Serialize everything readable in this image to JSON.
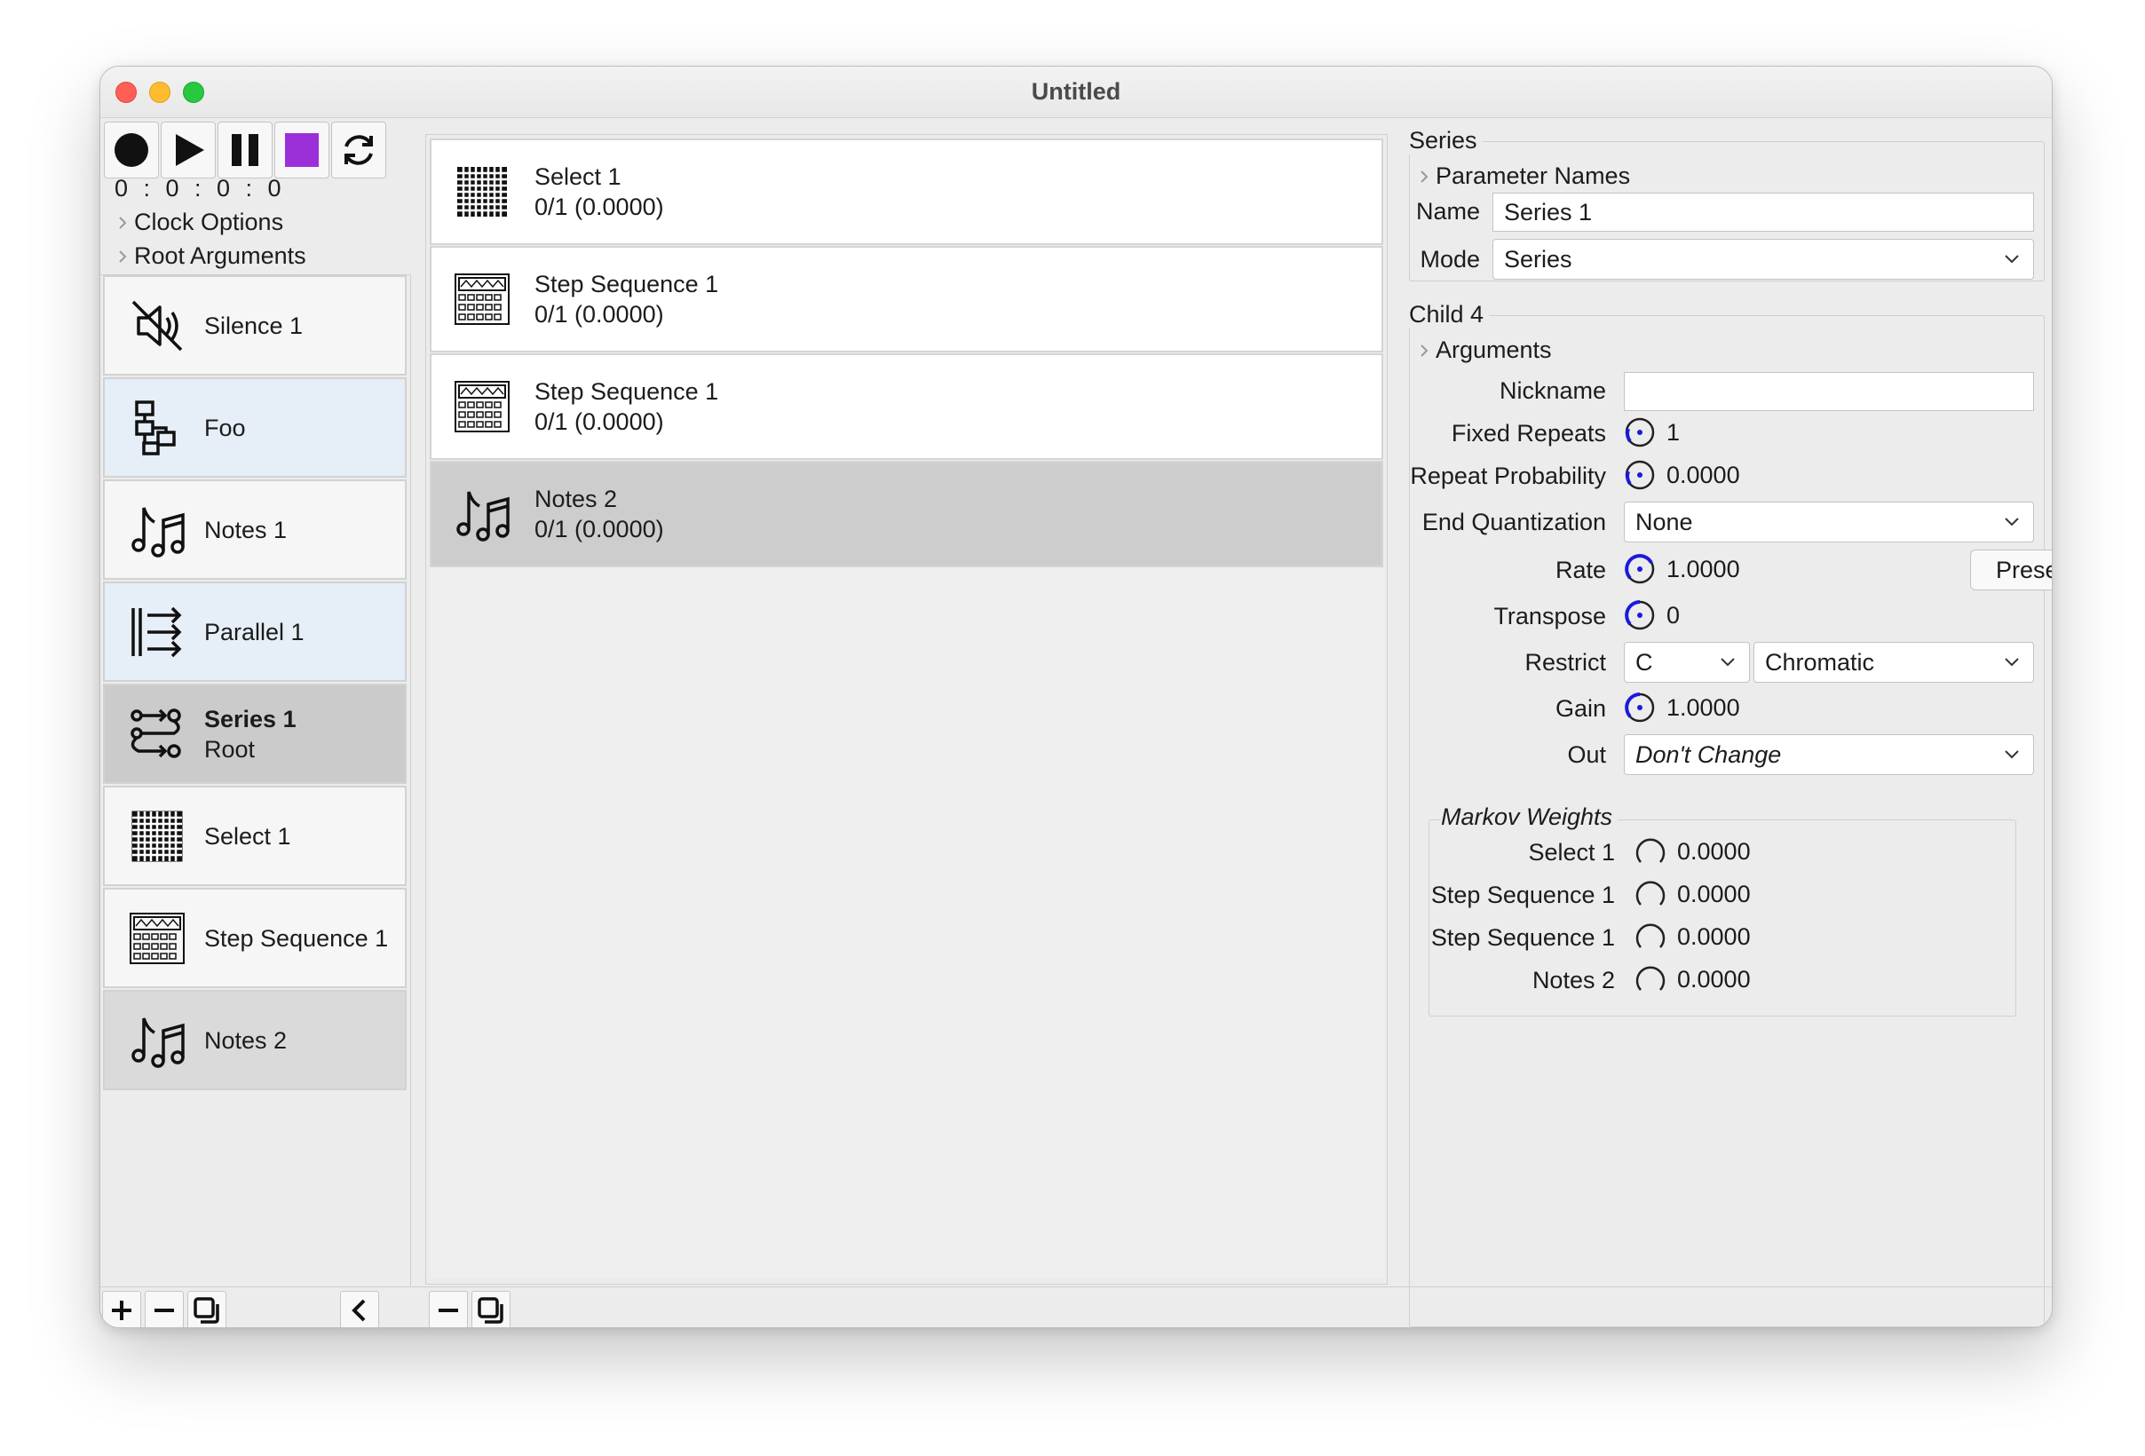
{
  "window": {
    "title": "Untitled"
  },
  "clock": {
    "display": "0 : 0 : 0 : 0"
  },
  "left_disclosures": {
    "clock_options": "Clock Options",
    "root_arguments": "Root Arguments"
  },
  "left_items": [
    {
      "label": "Silence 1",
      "sub": "",
      "icon": "mute-speaker-icon"
    },
    {
      "label": "Foo",
      "sub": "",
      "icon": "flowchart-icon"
    },
    {
      "label": "Notes 1",
      "sub": "",
      "icon": "music-notes-icon"
    },
    {
      "label": "Parallel 1",
      "sub": "",
      "icon": "parallel-arrows-icon"
    },
    {
      "label": "Series 1",
      "sub": "Root",
      "icon": "series-icon"
    },
    {
      "label": "Select 1",
      "sub": "",
      "icon": "grid-icon"
    },
    {
      "label": "Step Sequence 1",
      "sub": "",
      "icon": "step-sequencer-icon"
    },
    {
      "label": "Notes 2",
      "sub": "",
      "icon": "music-notes-icon"
    }
  ],
  "middle_items": [
    {
      "label": "Select 1",
      "sub": "0/1 (0.0000)",
      "icon": "grid-icon"
    },
    {
      "label": "Step Sequence 1",
      "sub": "0/1 (0.0000)",
      "icon": "step-sequencer-icon"
    },
    {
      "label": "Step Sequence 1",
      "sub": "0/1 (0.0000)",
      "icon": "step-sequencer-icon"
    },
    {
      "label": "Notes 2",
      "sub": "0/1 (0.0000)",
      "icon": "music-notes-icon"
    }
  ],
  "series_panel": {
    "title": "Series",
    "parameter_names": "Parameter Names",
    "name_label": "Name",
    "name_value": "Series 1",
    "mode_label": "Mode",
    "mode_value": "Series"
  },
  "child_panel": {
    "title": "Child 4",
    "arguments": "Arguments",
    "nickname_label": "Nickname",
    "nickname_value": "",
    "fixed_repeats_label": "Fixed Repeats",
    "fixed_repeats_value": "1",
    "repeat_probability_label": "Repeat Probability",
    "repeat_probability_value": "0.0000",
    "end_quantization_label": "End Quantization",
    "end_quantization_value": "None",
    "rate_label": "Rate",
    "rate_value": "1.0000",
    "presets_label": "Presets...",
    "transpose_label": "Transpose",
    "transpose_value": "0",
    "restrict_label": "Restrict",
    "restrict_key": "C",
    "restrict_scale": "Chromatic",
    "gain_label": "Gain",
    "gain_value": "1.0000",
    "out_label": "Out",
    "out_value": "Don't Change"
  },
  "markov": {
    "title": "Markov Weights",
    "rows": [
      {
        "label": "Select 1",
        "value": "0.0000"
      },
      {
        "label": "Step Sequence 1",
        "value": "0.0000"
      },
      {
        "label": "Step Sequence 1",
        "value": "0.0000"
      },
      {
        "label": "Notes 2",
        "value": "0.0000"
      }
    ]
  },
  "colors": {
    "stop_accent": "#9b30d9",
    "knob_accent": "#1a1adb"
  }
}
